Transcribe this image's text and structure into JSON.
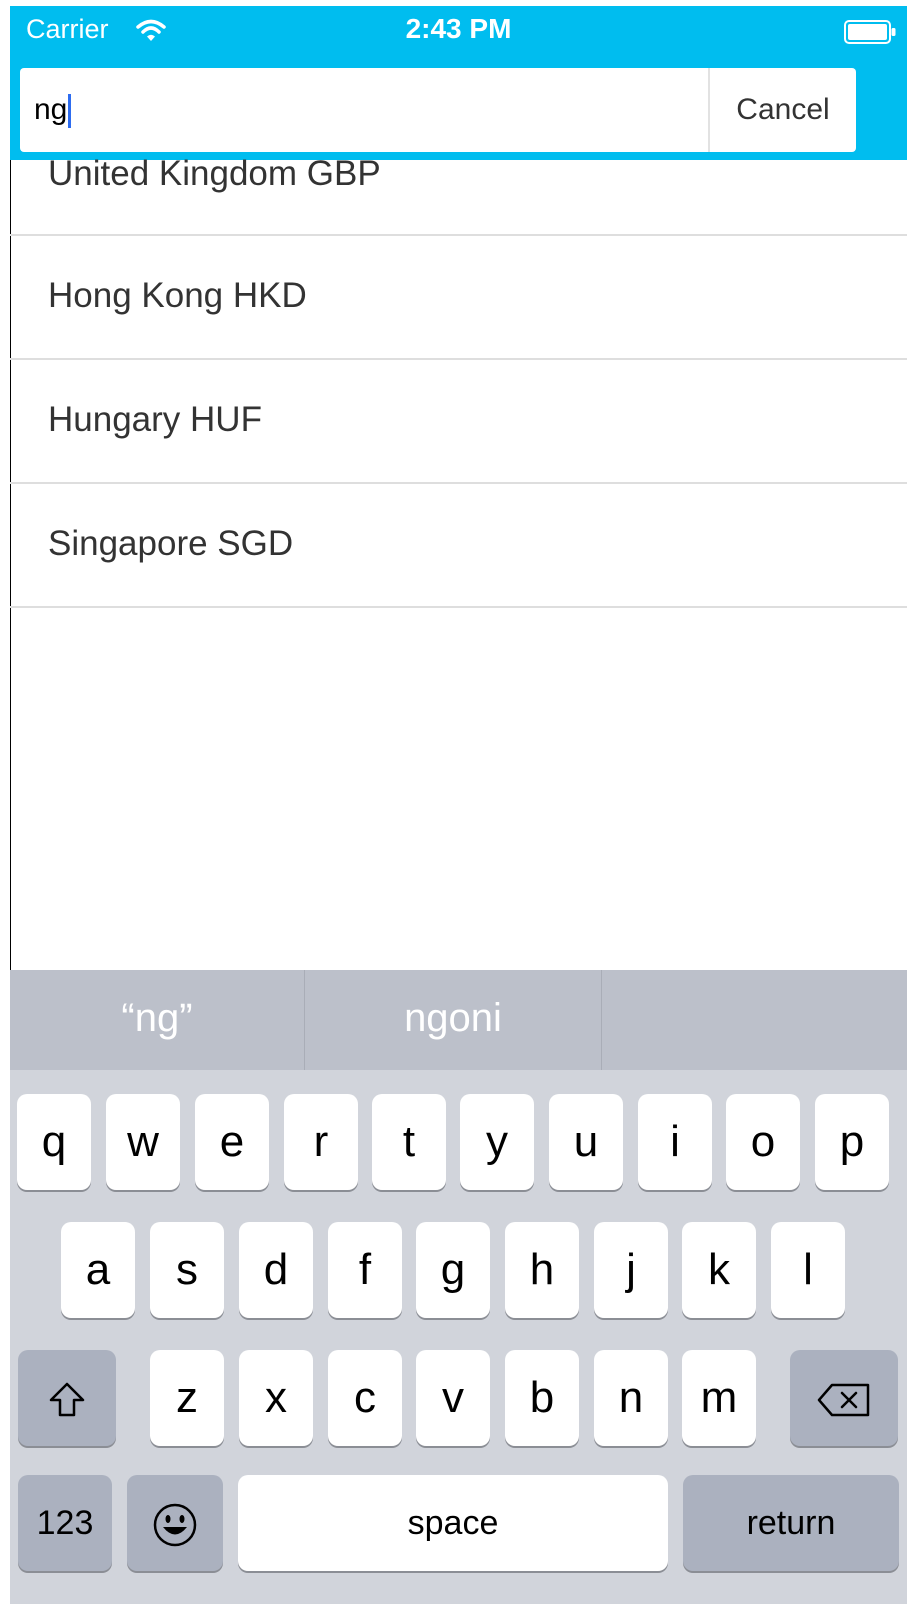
{
  "status_bar": {
    "carrier": "Carrier",
    "time": "2:43 PM"
  },
  "search": {
    "value": "ng",
    "cancel_label": "Cancel"
  },
  "results": [
    {
      "label": "United Kingdom GBP"
    },
    {
      "label": "Hong Kong HKD"
    },
    {
      "label": "Hungary HUF"
    },
    {
      "label": "Singapore SGD"
    }
  ],
  "keyboard": {
    "suggestions": [
      "“ng”",
      "ngoni",
      ""
    ],
    "row1": [
      "q",
      "w",
      "e",
      "r",
      "t",
      "y",
      "u",
      "i",
      "o",
      "p"
    ],
    "row2": [
      "a",
      "s",
      "d",
      "f",
      "g",
      "h",
      "j",
      "k",
      "l"
    ],
    "row3": [
      "z",
      "x",
      "c",
      "v",
      "b",
      "n",
      "m"
    ],
    "numbers_label": "123",
    "space_label": "space",
    "return_label": "return"
  },
  "colors": {
    "header": "#00bdef",
    "caret": "#2d6cf0",
    "keyboard_bg": "#d1d4db",
    "suggestion_bg": "#bcc0ca"
  }
}
